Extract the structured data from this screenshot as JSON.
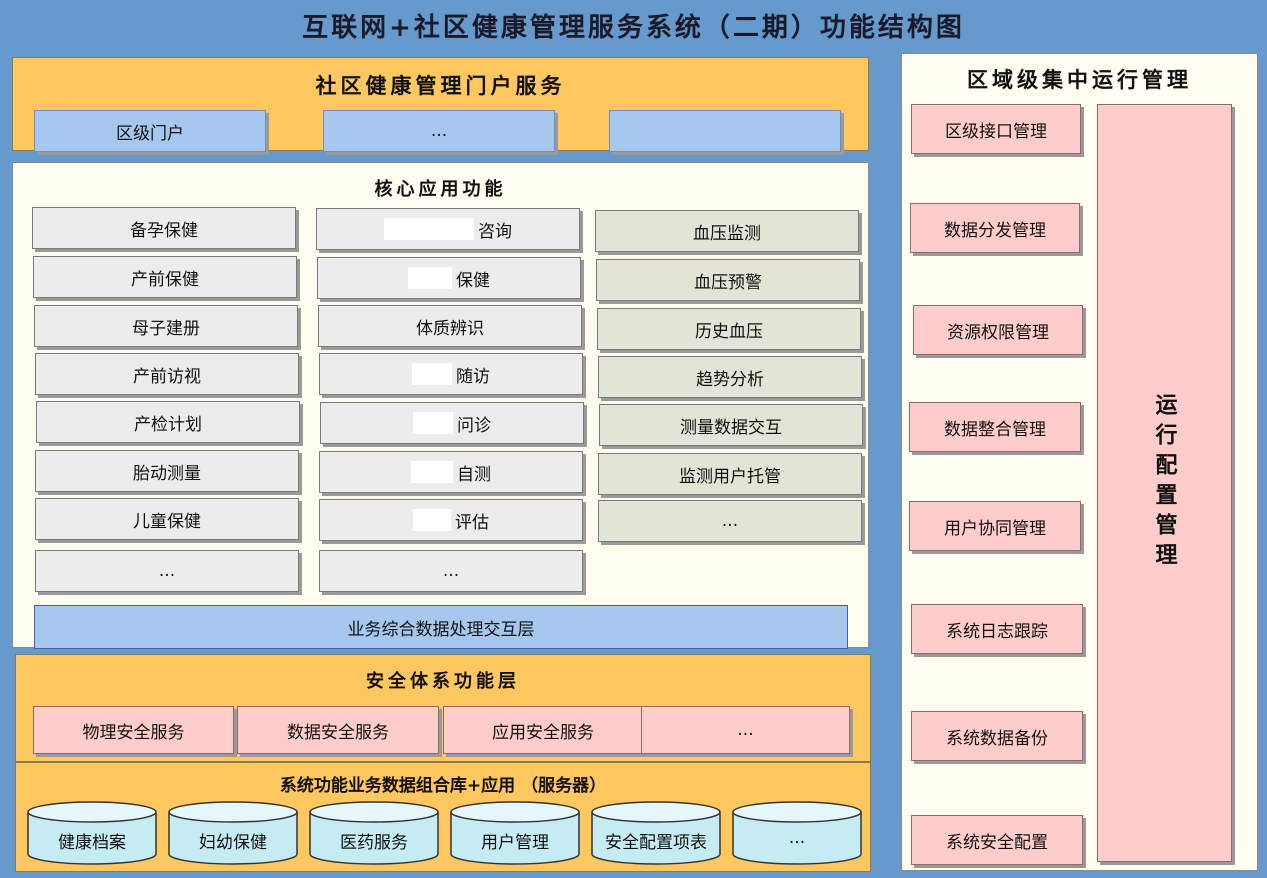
{
  "title": "互联网+社区健康管理服务系统（二期）功能结构图",
  "portal": {
    "heading": "社区健康管理门户服务",
    "items": [
      "区级门户",
      "...",
      ""
    ]
  },
  "core": {
    "heading": "核心应用功能",
    "col1": [
      "备孕保健",
      "产前保健",
      "母子建册",
      "产前访视",
      "产检计划",
      "胎动测量",
      "儿童保健",
      "..."
    ],
    "col2": [
      "咨询",
      "保健",
      "体质辨识",
      "随访",
      "问诊",
      "自测",
      "评估",
      "..."
    ],
    "col3": [
      "血压监测",
      "血压预警",
      "历史血压",
      "趋势分析",
      "测量数据交互",
      "监测用户托管",
      "..."
    ],
    "data_layer": "业务综合数据处理交互层"
  },
  "security": {
    "heading": "安全体系功能层",
    "items": [
      "物理安全服务",
      "数据安全服务",
      "应用安全服务",
      "..."
    ]
  },
  "database": {
    "heading": "系统功能业务数据组合库+应用 （服务器）",
    "items": [
      "健康档案",
      "妇幼保健",
      "医药服务",
      "用户管理",
      "安全配置项表",
      "..."
    ]
  },
  "regional": {
    "heading": "区域级集中运行管理",
    "items": [
      "区级接口管理",
      "数据分发管理",
      "资源权限管理",
      "数据整合管理",
      "用户协同管理",
      "系统日志跟踪",
      "系统数据备份",
      "系统安全配置"
    ],
    "side": "运行配置管理"
  }
}
